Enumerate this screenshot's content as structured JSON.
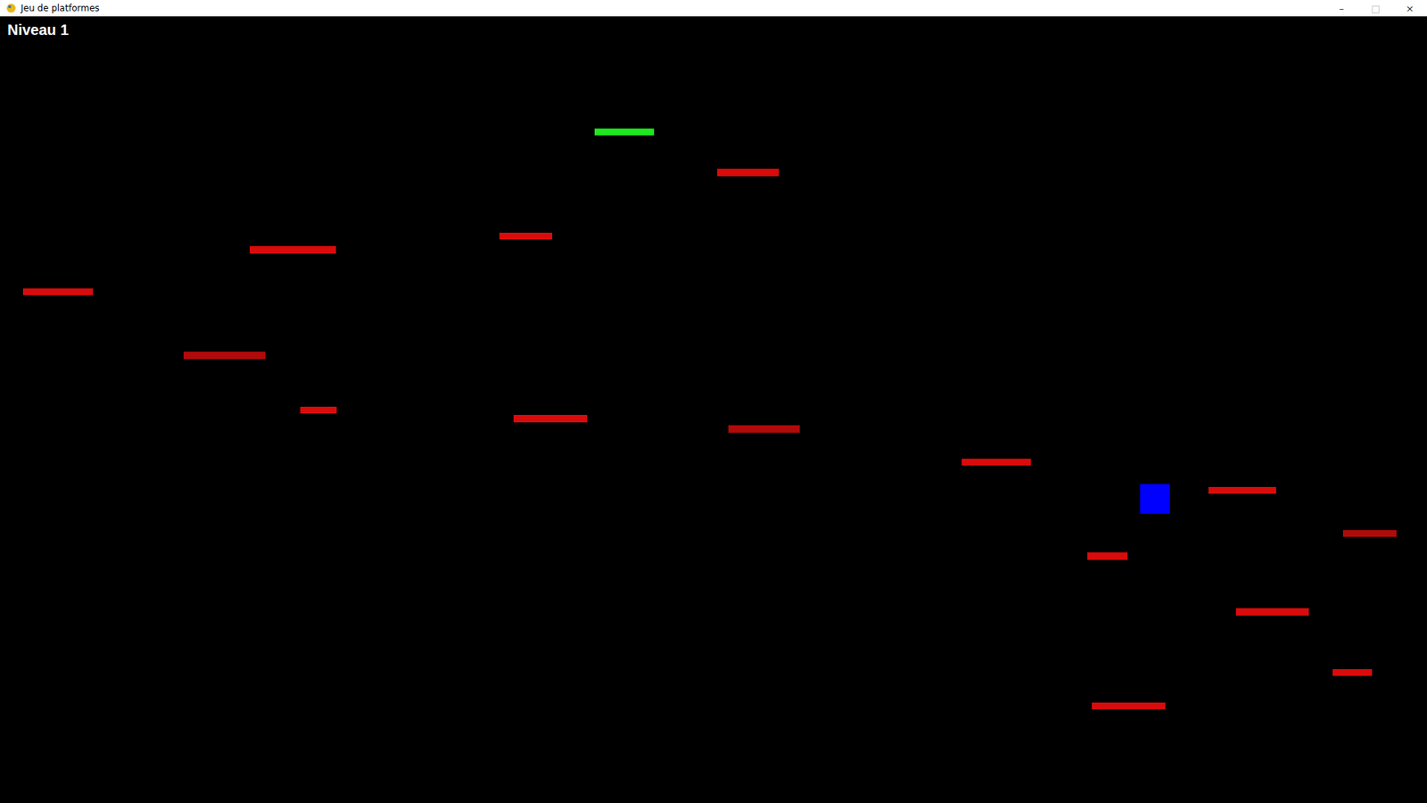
{
  "window": {
    "title": "Jeu de platformes",
    "controls": [
      "–",
      "□",
      "×"
    ]
  },
  "hud": {
    "level": "Niveau 1"
  },
  "goal": {
    "color": "#1ee81e"
  },
  "player": {
    "color": "#0000ff"
  },
  "platforms": [
    {
      "color": "#d90b0b"
    },
    {
      "color": "#d90b0b"
    },
    {
      "color": "#d90b0b"
    },
    {
      "color": "#d90b0b"
    },
    {
      "color": "#b00a0a"
    },
    {
      "color": "#d90b0b"
    },
    {
      "color": "#d90b0b"
    },
    {
      "color": "#b00a0a"
    },
    {
      "color": "#d90b0b"
    },
    {
      "color": "#d90b0b"
    },
    {
      "color": "#b00a0a"
    },
    {
      "color": "#d90b0b"
    },
    {
      "color": "#d90b0b"
    },
    {
      "color": "#d90b0b"
    },
    {
      "color": "#d90b0b"
    }
  ]
}
